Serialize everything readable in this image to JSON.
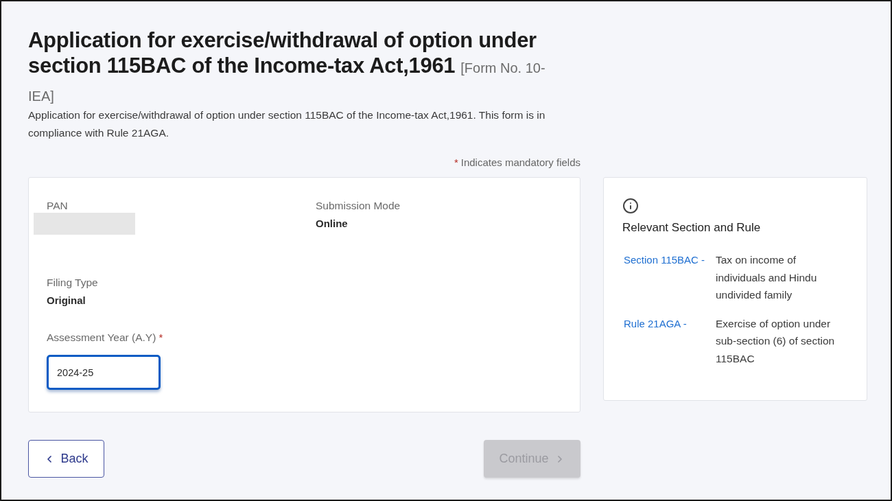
{
  "header": {
    "title": "Application for exercise/withdrawal of option under section 115BAC of the Income-tax Act,1961",
    "form_number": "[Form No. 10-IEA]",
    "description": "Application for exercise/withdrawal of option under section 115BAC of the Income-tax Act,1961. This form is in compliance with Rule 21AGA."
  },
  "mandatory_note": {
    "mark": "*",
    "text": "Indicates mandatory fields"
  },
  "details": {
    "rows": [
      [
        {
          "kind": "redacted",
          "label": "PAN"
        },
        {
          "kind": "text",
          "label": "Submission Mode",
          "value": "Online"
        }
      ],
      [
        {
          "kind": "text",
          "label": "Filing Type",
          "value": "Original"
        }
      ],
      [
        {
          "kind": "input",
          "label": "Assessment Year (A.Y)",
          "required_mark": "*",
          "value": "2024-25",
          "focused": true
        }
      ]
    ]
  },
  "info_panel": {
    "heading": "Relevant Section and Rule",
    "references": [
      {
        "term": "Section 115BAC -",
        "text": "Tax on income of individuals and Hindu undivided family"
      },
      {
        "term": "Rule 21AGA -",
        "text": "Exercise of option under sub-section (6) of section 115BAC"
      }
    ]
  },
  "actions": [
    {
      "kind": "back",
      "label": "Back",
      "disabled": false
    },
    {
      "kind": "continue",
      "label": "Continue",
      "disabled": true
    }
  ]
}
